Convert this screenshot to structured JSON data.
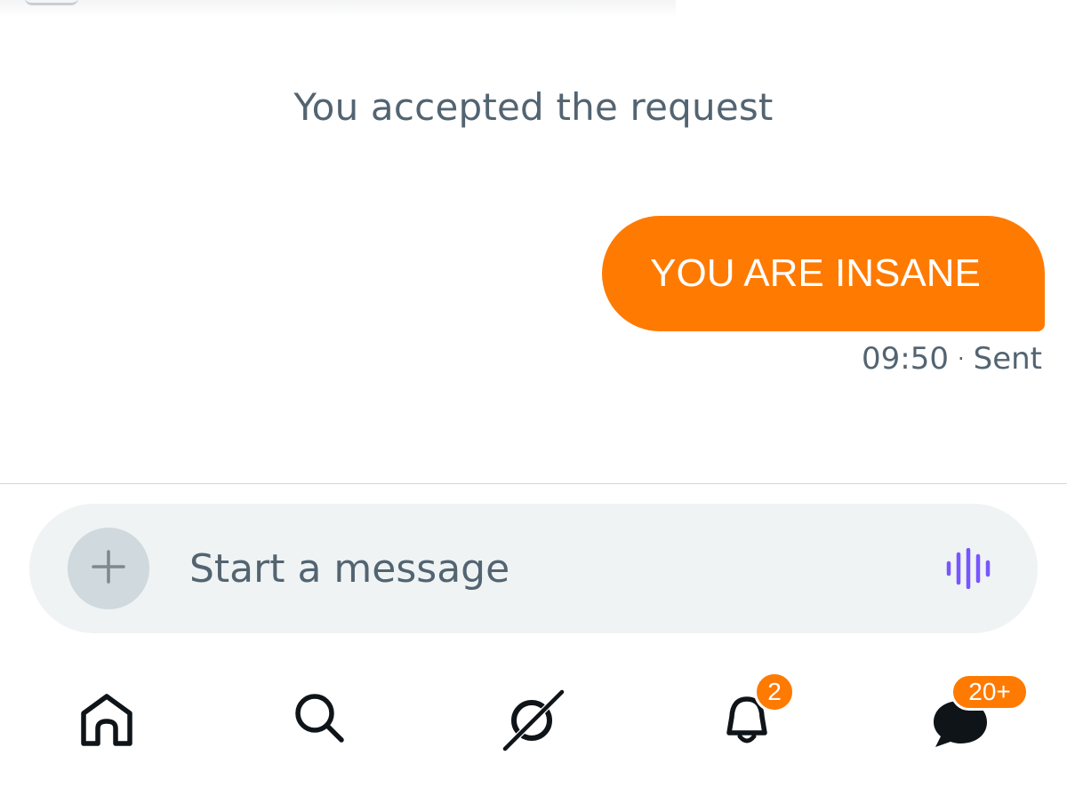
{
  "conversation": {
    "system_note": "You accepted the request",
    "messages": [
      {
        "text": "YOU ARE INSANE",
        "time": "09:50",
        "status": "Sent"
      }
    ]
  },
  "composer": {
    "placeholder": "Start a message"
  },
  "tabbar": {
    "items": [
      {
        "icon": "home-icon"
      },
      {
        "icon": "search-icon"
      },
      {
        "icon": "grok-icon"
      },
      {
        "icon": "notifications-bell-icon",
        "badge": "2"
      },
      {
        "icon": "messages-icon",
        "badge": "20+"
      }
    ]
  },
  "colors": {
    "accent": "#ff7a00",
    "secondary_text": "#536471",
    "composer_bg": "#eff3f4",
    "voice_icon": "#7856ff"
  }
}
